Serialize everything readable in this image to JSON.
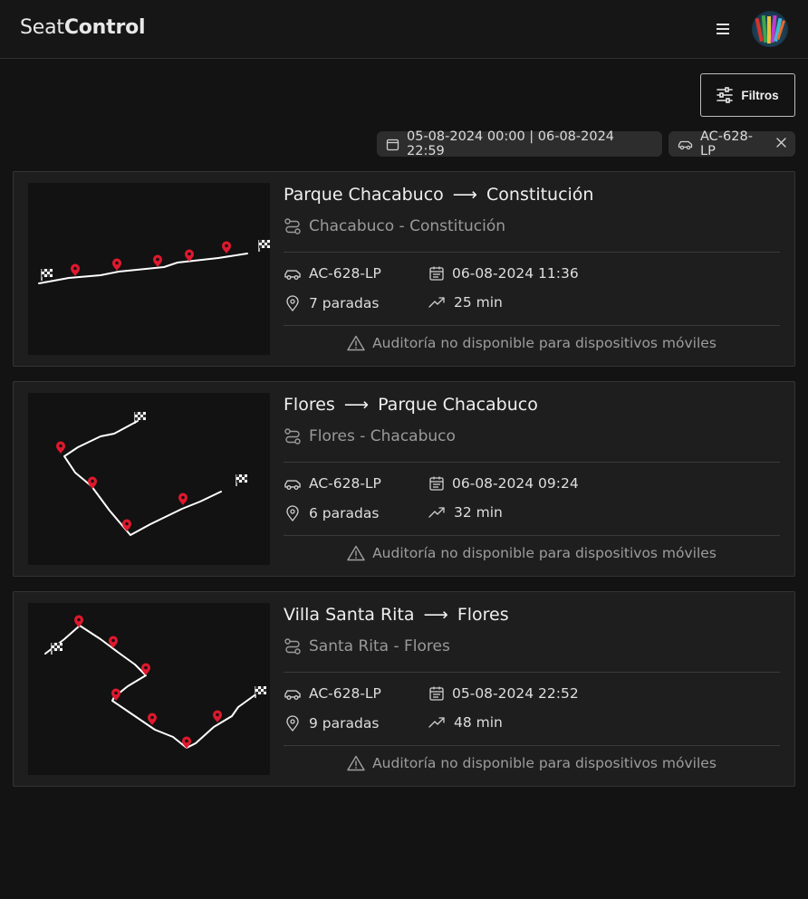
{
  "app": {
    "brand_light": "Seat",
    "brand_bold": "Control"
  },
  "toolbar": {
    "filters_label": "Filtros"
  },
  "chips": {
    "date_range": "05-08-2024 00:00 | 06-08-2024 22:59",
    "vehicle": "AC-628-LP"
  },
  "trips": [
    {
      "origin": "Parque Chacabuco",
      "destination": "Constitución",
      "route": "Chacabuco - Constitución",
      "plate": "AC-628-LP",
      "datetime": "06-08-2024 11:36",
      "stops": "7 paradas",
      "duration": "25 min",
      "warning": "Auditoría no disponible para dispositivos móviles"
    },
    {
      "origin": "Flores",
      "destination": "Parque Chacabuco",
      "route": "Flores - Chacabuco",
      "plate": "AC-628-LP",
      "datetime": "06-08-2024 09:24",
      "stops": "6 paradas",
      "duration": "32 min",
      "warning": "Auditoría no disponible para dispositivos móviles"
    },
    {
      "origin": "Villa Santa Rita",
      "destination": "Flores",
      "route": "Santa Rita - Flores",
      "plate": "AC-628-LP",
      "datetime": "05-08-2024 22:52",
      "stops": "9 paradas",
      "duration": "48 min",
      "warning": "Auditoría no disponible para dispositivos móviles"
    }
  ],
  "colors": {
    "background": "#131313",
    "card": "#1e1e1e",
    "marker": "#e0182d",
    "route_line": "#ffffff"
  },
  "icons": {
    "menu": "hamburger-icon",
    "filters": "sliders-icon",
    "calendar": "calendar-icon",
    "car": "car-icon",
    "close": "close-icon",
    "route": "route-icon",
    "pin": "map-pin-icon",
    "trend": "trending-up-icon",
    "warning": "warning-triangle-icon",
    "flag": "checkered-flag-icon"
  }
}
